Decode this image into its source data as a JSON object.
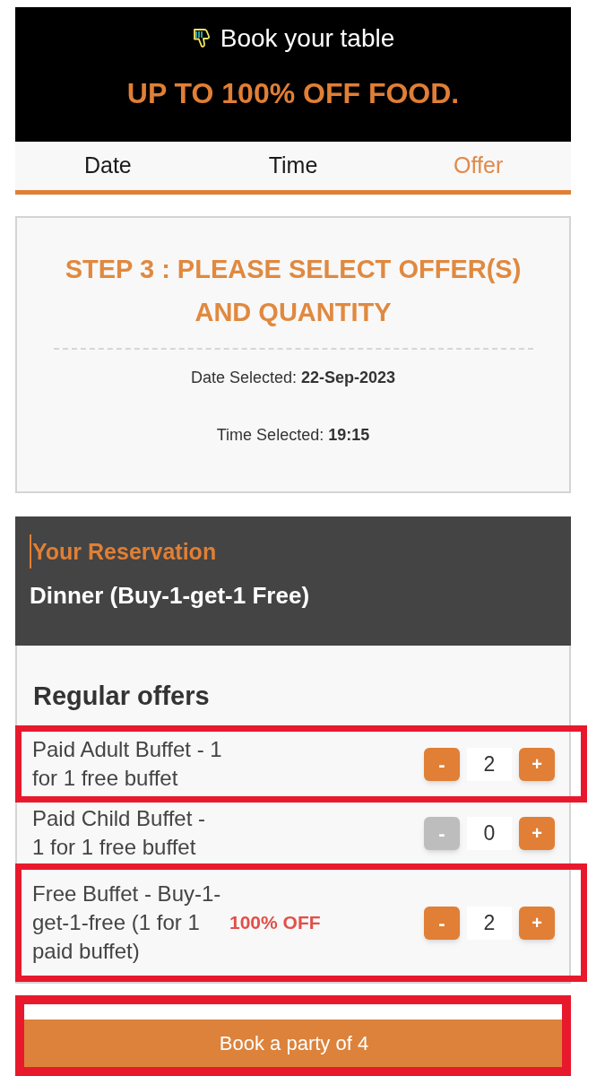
{
  "header": {
    "title": "Book your table",
    "promo": "UP TO 100% OFF FOOD."
  },
  "tabs": [
    {
      "label": "Date",
      "selected": false
    },
    {
      "label": "Time",
      "selected": false
    },
    {
      "label": "Offer",
      "selected": true
    }
  ],
  "step": {
    "title": "STEP 3 : PLEASE SELECT OFFER(S) AND QUANTITY",
    "details": [
      "Date Selected: **22-Sep-2023**",
      "Time Selected: **19:15**"
    ]
  },
  "reservation": {
    "heading": "Your Reservation",
    "text_cursor": true,
    "meal": "Dinner (Buy-1-get-1 Free)"
  },
  "offers": {
    "heading": "Regular offers",
    "items": [
      {
        "label": "Paid Adult Buffet - 1 for 1 free buffet",
        "quantity": "2",
        "decrease": {
          "label": "-",
          "disabled": false
        },
        "increase": {
          "label": "+",
          "disabled": false
        },
        "highlighted": true
      },
      {
        "label": "Paid Child Buffet - 1 for 1 free buffet",
        "quantity": "0",
        "decrease": {
          "label": "-",
          "disabled": true
        },
        "increase": {
          "label": "+",
          "disabled": false
        },
        "highlighted": false
      },
      {
        "label": "Free Buffet - Buy-1-get-1-free (1 for 1 paid buffet)",
        "discount": "100% OFF",
        "quantity": "2",
        "decrease": {
          "label": "-",
          "disabled": false
        },
        "increase": {
          "label": "+",
          "disabled": false
        },
        "highlighted": true
      }
    ]
  },
  "book_button": {
    "label": "Book a party of 4",
    "highlighted": true
  }
}
